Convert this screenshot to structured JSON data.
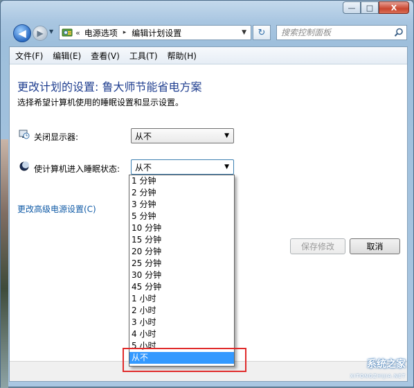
{
  "window": {
    "caption": {
      "minimize": "—",
      "maximize": "□",
      "close": "X"
    }
  },
  "nav": {
    "back_glyph": "◀",
    "forward_glyph": "▶",
    "breadcrumb_sep": "«",
    "breadcrumb": [
      "电源选项",
      "编辑计划设置"
    ],
    "breadcrumb_arrow": "▸",
    "refresh_glyph": "↻",
    "search_placeholder": "搜索控制面板"
  },
  "menubar": [
    "文件(F)",
    "编辑(E)",
    "查看(V)",
    "工具(T)",
    "帮助(H)"
  ],
  "main": {
    "title": "更改计划的设置: 鲁大师节能省电方案",
    "subtitle": "选择希望计算机使用的睡眠设置和显示设置。",
    "display_off_label": "关闭显示器:",
    "display_off_value": "从不",
    "sleep_label": "使计算机进入睡眠状态:",
    "sleep_value": "从不",
    "advanced_link": "更改高级电源设置(C)",
    "save_button": "保存修改",
    "cancel_button": "取消"
  },
  "dropdown": {
    "options": [
      "1 分钟",
      "2 分钟",
      "3 分钟",
      "5 分钟",
      "10 分钟",
      "15 分钟",
      "20 分钟",
      "25 分钟",
      "30 分钟",
      "45 分钟",
      "1 小时",
      "2 小时",
      "3 小时",
      "4 小时",
      "5 小时",
      "从不"
    ],
    "selected_index": 15
  },
  "watermark": {
    "text": "系统之家",
    "sub": "XITONGZHIJIA.NET"
  },
  "colors": {
    "highlight_box": "#e02a2a",
    "selection": "#3399ff",
    "title": "#1e3d8f",
    "link": "#0f5aa6"
  }
}
